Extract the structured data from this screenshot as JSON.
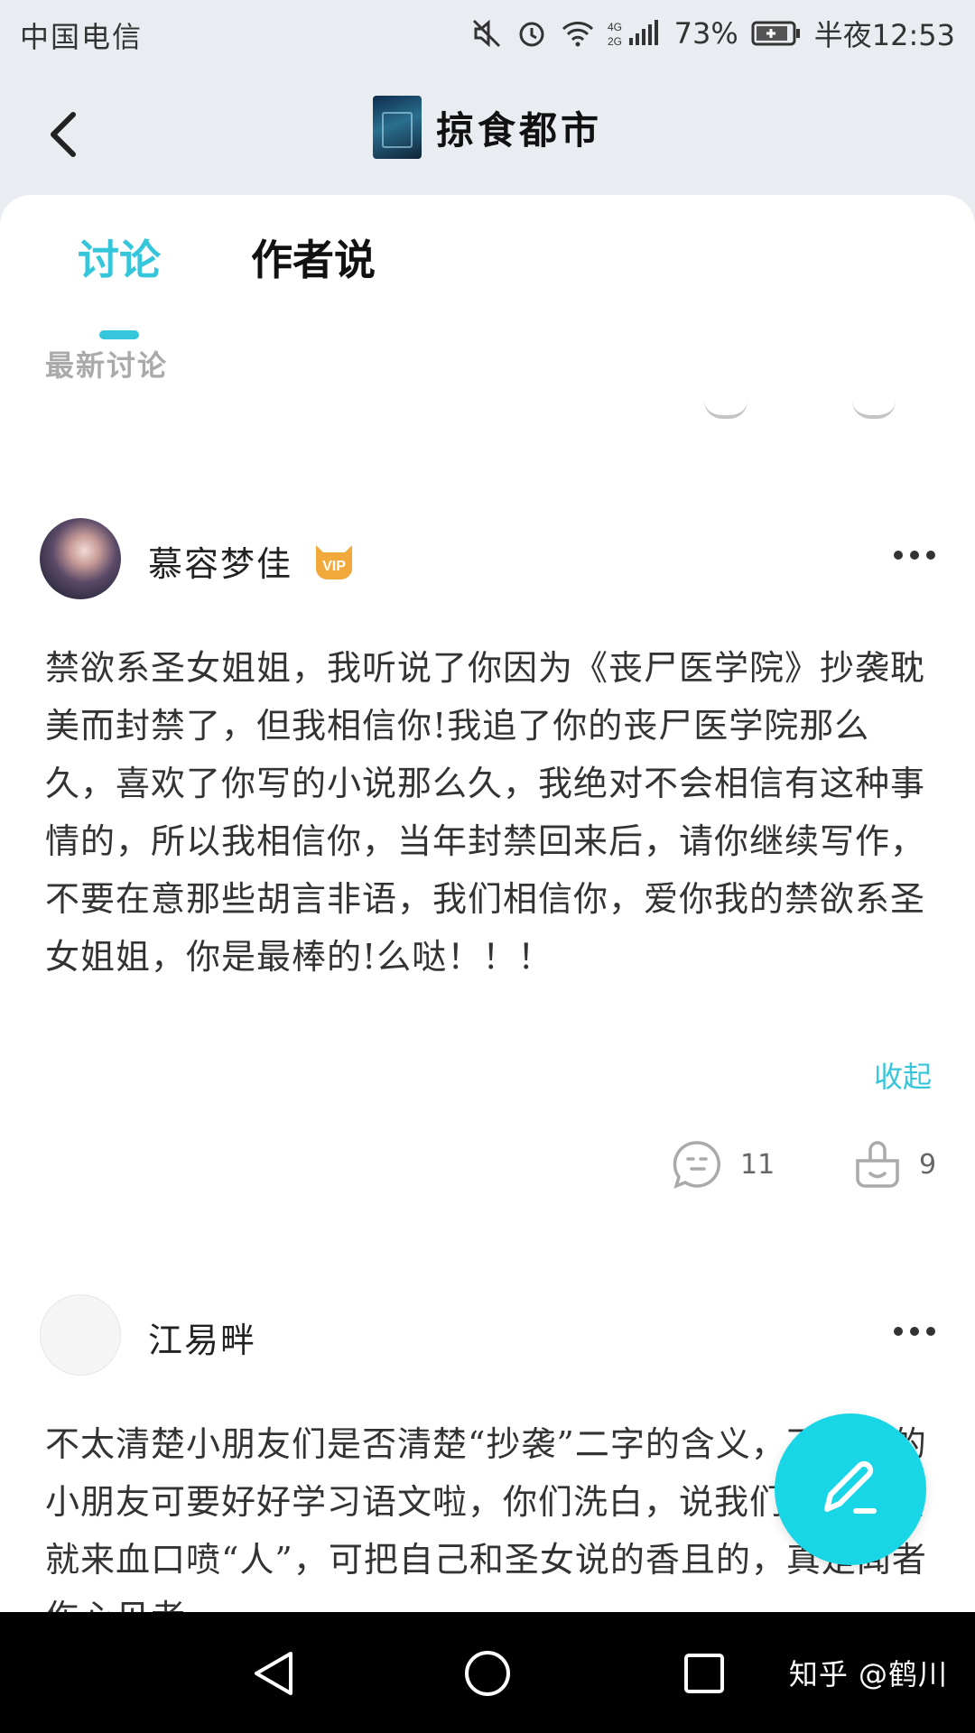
{
  "status_bar": {
    "carrier": "中国电信",
    "battery_percent": "73%",
    "time": "半夜12:53",
    "network": "4G 2G"
  },
  "header": {
    "back_icon": "chevron-left-icon",
    "book_title": "掠食都市"
  },
  "tabs": [
    {
      "label": "讨论",
      "active": true
    },
    {
      "label": "作者说",
      "active": false
    }
  ],
  "section_label": "最新讨论",
  "posts": [
    {
      "username": "慕容梦佳",
      "vip_badge": "VIP",
      "body": "禁欲系圣女姐姐，我听说了你因为《丧尸医学院》抄袭耽美而封禁了，但我相信你!我追了你的丧尸医学院那么久，喜欢了你写的小说那么久，我绝对不会相信有这种事情的，所以我相信你，当年封禁回来后，请你继续写作，不要在意那些胡言非语，我们相信你，爱你我的禁欲系圣女姐姐，你是最棒的!么哒！！！",
      "collapse_label": "收起",
      "comment_count": "11",
      "like_count": "9"
    },
    {
      "username": "江易畔",
      "body": "不太清楚小朋友们是否清楚“抄袭”二字的含义，不清楚的小朋友可要好好学习语文啦，你们洗白，说我们没有证据就来血口喷“人”，可把自己和圣女说的香且的，真是闻者伤心见者"
    }
  ],
  "colors": {
    "accent": "#35c6dc",
    "fab": "#18d6e6"
  },
  "watermark": "知乎 @鹤川"
}
